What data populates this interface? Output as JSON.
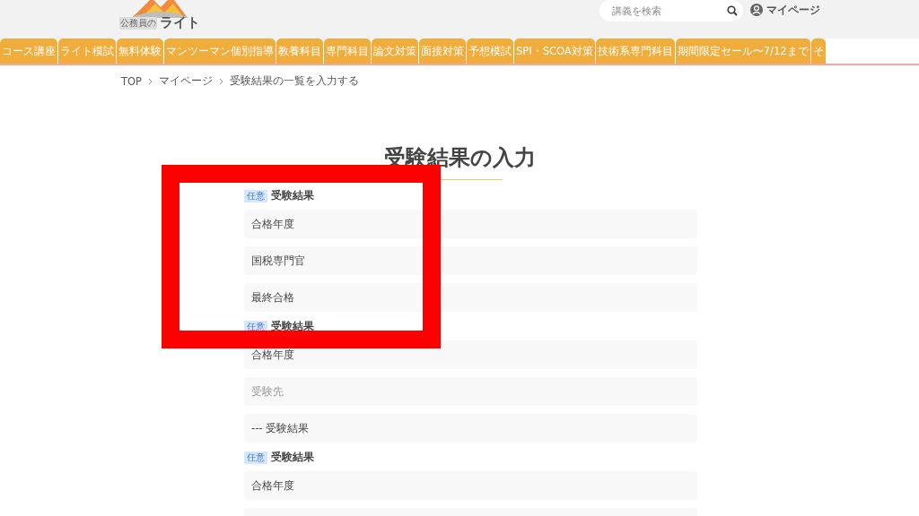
{
  "header": {
    "logo": {
      "tagline": "公務員の",
      "name": "ライト"
    },
    "search": {
      "placeholder": "講義を検索"
    },
    "mypage": "マイページ"
  },
  "nav": [
    {
      "label": "コース講座"
    },
    {
      "label": "ライト模試"
    },
    {
      "label": "無料体験"
    },
    {
      "label": "マンツーマン個別指導"
    },
    {
      "label": "教養科目"
    },
    {
      "label": "専門科目"
    },
    {
      "label": "論文対策"
    },
    {
      "label": "面接対策"
    },
    {
      "label": "予想模試"
    },
    {
      "label": "SPI・SCOA対策"
    },
    {
      "label": "技術系専門科目"
    },
    {
      "label": "期間限定セール〜7/12まで"
    },
    {
      "label": "そ"
    }
  ],
  "breadcrumb": [
    "TOP",
    "マイページ",
    "受験結果の一覧を入力する"
  ],
  "title": "受験結果の入力",
  "groups": [
    {
      "badge": "任意",
      "label": "受験結果",
      "fields": [
        {
          "value": "合格年度"
        },
        {
          "value": "国税専門官"
        },
        {
          "value": "最終合格"
        }
      ]
    },
    {
      "badge": "任意",
      "label": "受験結果",
      "fields": [
        {
          "value": "合格年度"
        },
        {
          "placeholder": "受験先"
        },
        {
          "value": "--- 受験結果"
        }
      ]
    },
    {
      "badge": "任意",
      "label": "受験結果",
      "fields": [
        {
          "value": "合格年度"
        }
      ]
    }
  ],
  "annotation": {
    "kind": "highlight-frame"
  }
}
